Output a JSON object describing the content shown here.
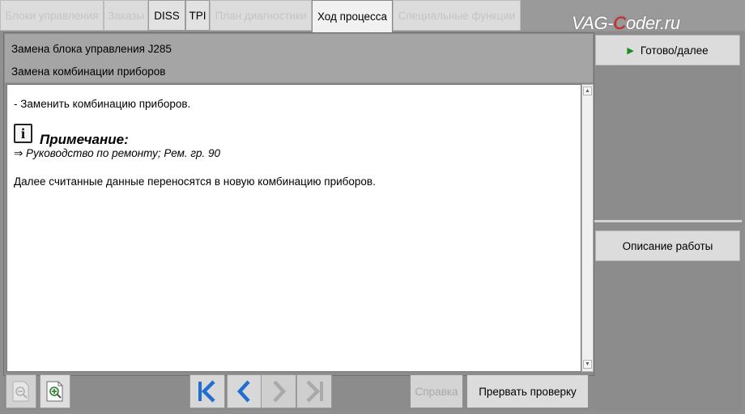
{
  "tabs": [
    {
      "label": "Блоки управления",
      "state": "disabled"
    },
    {
      "label": "Заказы",
      "state": "disabled"
    },
    {
      "label": "DISS",
      "state": "enabled"
    },
    {
      "label": "TPI",
      "state": "enabled"
    },
    {
      "label": "План диагностики",
      "state": "disabled"
    },
    {
      "label": "Ход процесса",
      "state": "active"
    },
    {
      "label": "Специальные функции",
      "state": "disabled"
    }
  ],
  "brand": {
    "prefix": "VAG-",
    "highlight": "C",
    "suffix": "oder.ru"
  },
  "header": {
    "line1": "Замена блока управления J285",
    "line2": "Замена комбинации приборов"
  },
  "content": {
    "instruction": "- Заменить комбинацию приборов.",
    "note_title": "Примечание:",
    "note_link": "⇒ Руководство по ремонту; Рем. гр. 90",
    "paragraph": "Далее считанные данные переносятся в новую комбинацию приборов."
  },
  "toolbar": {
    "help_label": "Справка",
    "abort_label": "Прервать проверку"
  },
  "sidebar": {
    "done_label": "Готово/далее",
    "description_label": "Описание работы"
  },
  "colors": {
    "accent_blue": "#1e6fd0",
    "play_green": "#1e8a1e",
    "brand_red": "#d61f1f"
  }
}
